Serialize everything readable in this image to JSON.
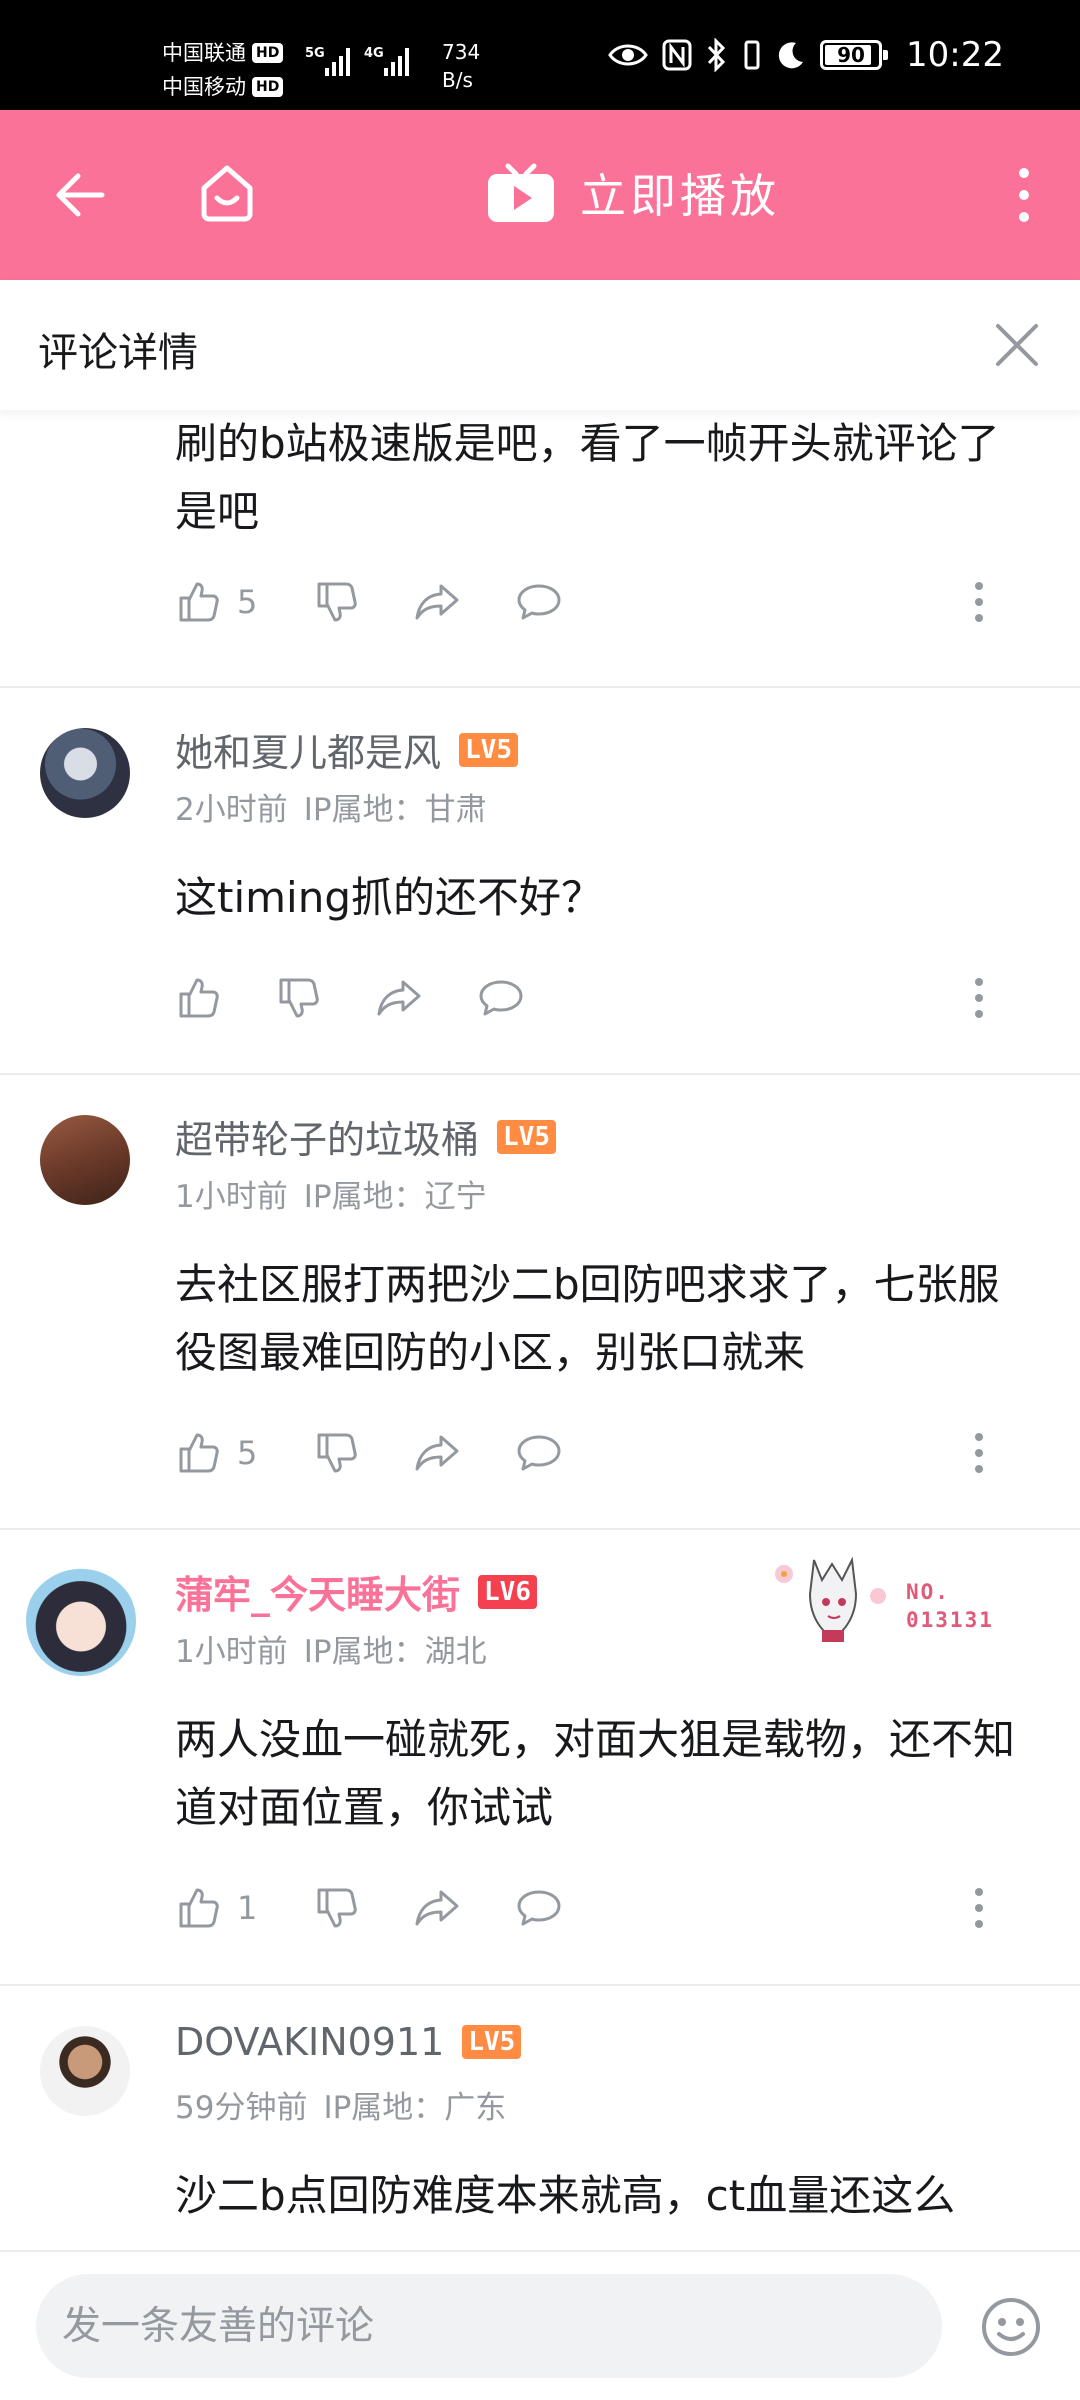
{
  "status_bar": {
    "carrier1": "中国联通",
    "carrier2": "中国移动",
    "hd_badge": "HD",
    "net1": "5G",
    "net2": "4G",
    "speed_value": "734",
    "speed_unit": "B/s",
    "battery": "90",
    "time": "10:22"
  },
  "app_bar": {
    "play_label": "立即播放"
  },
  "detail": {
    "title": "评论详情"
  },
  "comments": [
    {
      "text": "刷的b站极速版是吧，看了一帧开头就评论了是吧",
      "likes": "5"
    },
    {
      "user": "她和夏儿都是风",
      "level": "LV5",
      "time": "2小时前",
      "ip": "IP属地：甘肃",
      "text": "这timing抓的还不好？",
      "likes": ""
    },
    {
      "user": "超带轮子的垃圾桶",
      "level": "LV5",
      "time": "1小时前",
      "ip": "IP属地：辽宁",
      "text": "去社区服打两把沙二b回防吧求求了，七张服役图最难回防的小区，别张口就来",
      "likes": "5"
    },
    {
      "user": "蒲牢_今天睡大街",
      "level": "LV6",
      "time": "1小时前",
      "ip": "IP属地：湖北",
      "text": "两人没血一碰就死，对面大狙是载物，还不知道对面位置，你试试",
      "likes": "1",
      "fan_badge_line1": "NO.",
      "fan_badge_line2": "013131"
    },
    {
      "user": "DOVAKIN0911",
      "level": "LV5",
      "time": "59分钟前",
      "ip": "IP属地：广东",
      "text": "沙二b点回防难度本来就高，ct血量还这么"
    }
  ],
  "input": {
    "placeholder": "发一条友善的评论"
  },
  "colors": {
    "brand_pink": "#fb7299",
    "level5": "#ff8c42",
    "level6": "#f4404f"
  },
  "icons": [
    "back-arrow-icon",
    "home-icon",
    "tv-play-icon",
    "more-vertical-icon",
    "close-icon",
    "thumb-up-icon",
    "thumb-down-icon",
    "share-icon",
    "reply-icon",
    "emoji-icon"
  ]
}
